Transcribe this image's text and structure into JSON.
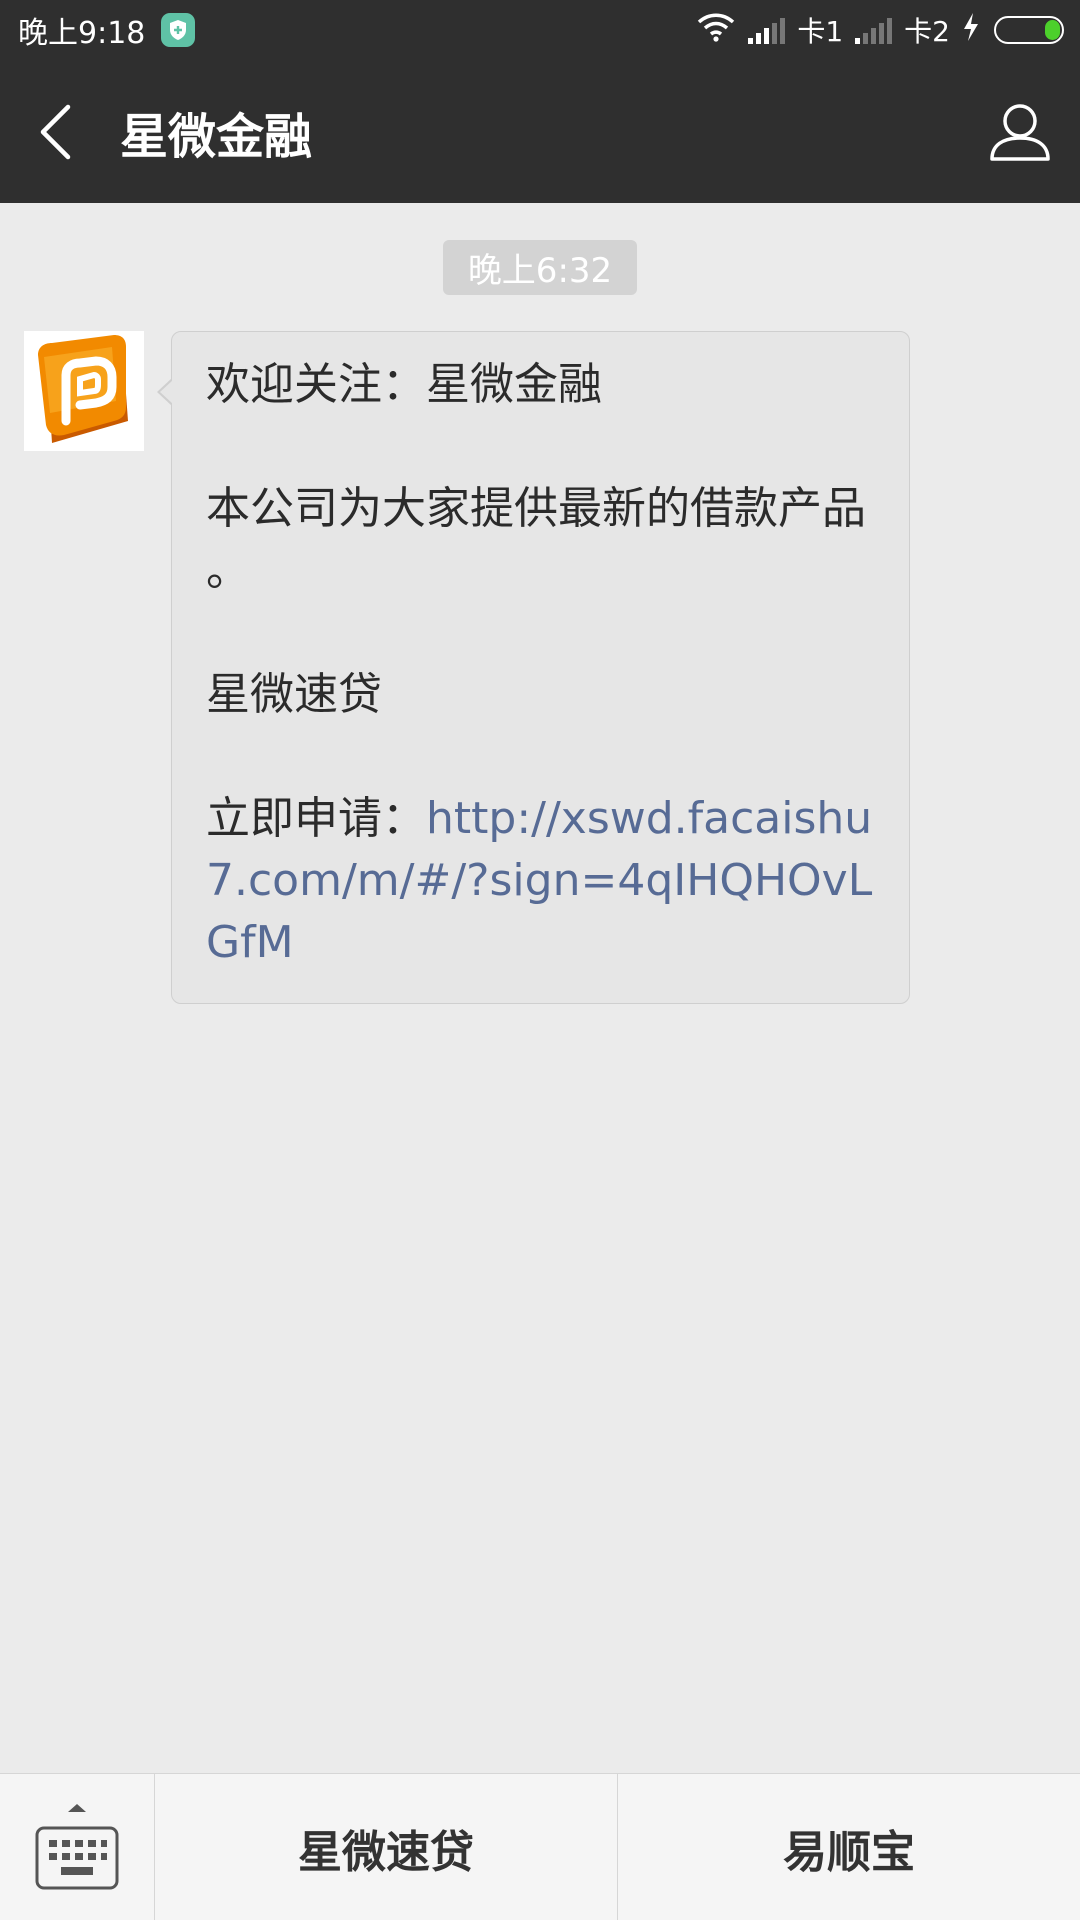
{
  "status_bar": {
    "time": "晚上9:18",
    "sim1": "卡1",
    "sim2": "卡2",
    "battery_level": 0.25
  },
  "header": {
    "title": "星微金融"
  },
  "chat": {
    "timestamp": "晚上6:32",
    "message": {
      "line1": "欢迎关注：星微金融",
      "line2": "本公司为大家提供最新的借款产品 。",
      "line3": "星微速贷",
      "apply_label": "立即申请：",
      "link": "http://xswd.facaishu7.com/m/#/?sign=4qIHQHOvLGfM"
    }
  },
  "bottom_menu": {
    "items": [
      {
        "label": "星微速贷"
      },
      {
        "label": "易顺宝"
      }
    ]
  },
  "colors": {
    "bar": "#2f2f2f",
    "chat_bg": "#ebebeb",
    "bubble": "#e6e6e6",
    "link": "#576b95",
    "battery": "#4cd02b",
    "shield": "#5fc2a6"
  }
}
